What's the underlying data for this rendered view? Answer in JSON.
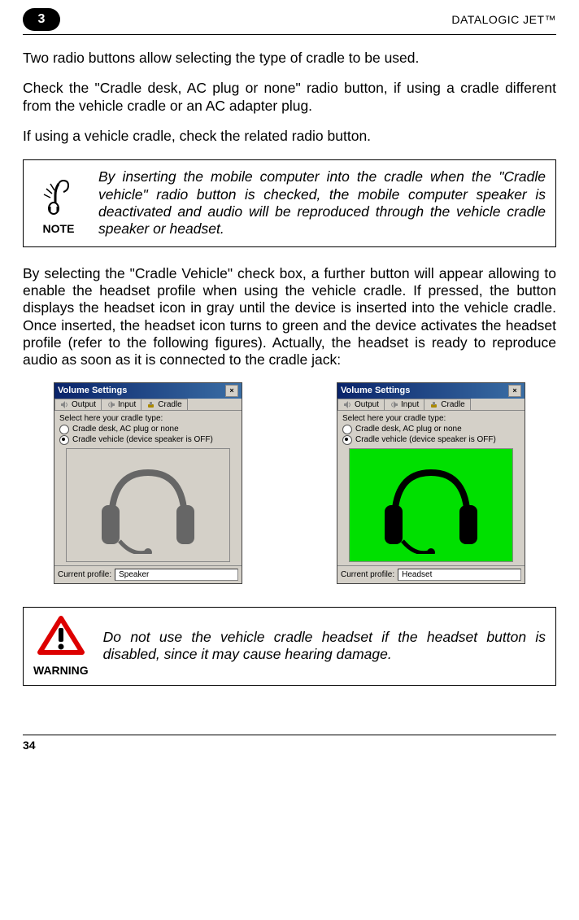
{
  "header": {
    "chapter": "3",
    "title": "DATALOGIC JET™"
  },
  "para1": "Two radio buttons allow selecting the type of cradle to be used.",
  "para2": "Check the \"Cradle desk, AC plug or none\" radio button, if using a cradle different from the vehicle cradle or an AC adapter plug.",
  "para3": "If using a vehicle cradle, check the related radio button.",
  "note": {
    "label": "NOTE",
    "text": "By inserting the mobile computer into the cradle when the \"Cradle vehicle\" radio button is checked, the mobile computer speaker is deactivated and audio will be reproduced through the vehicle cradle speaker or headset."
  },
  "para4": "By selecting the \"Cradle Vehicle\" check box, a further button will appear allowing to enable the headset profile when using the vehicle cradle. If pressed, the button displays the headset icon in gray until the device is inserted into the vehicle cradle. Once inserted, the headset icon turns to green and the device activates the headset profile (refer to the following figures). Actually, the headset is ready to reproduce audio as soon as it is connected to the cradle jack:",
  "dialog": {
    "title": "Volume Settings",
    "tabs": {
      "output": "Output",
      "input": "Input",
      "cradle": "Cradle"
    },
    "select_label": "Select here your cradle type:",
    "radio1": "Cradle desk, AC plug or none",
    "radio2_off": "Cradle vehicle (device speaker is OFF)",
    "profile_label": "Current profile:",
    "profile_speaker": "Speaker",
    "profile_headset": "Headset"
  },
  "warning": {
    "label": "WARNING",
    "text": "Do not use the vehicle cradle headset if the headset button is disabled, since it may cause hearing damage."
  },
  "page_number": "34"
}
